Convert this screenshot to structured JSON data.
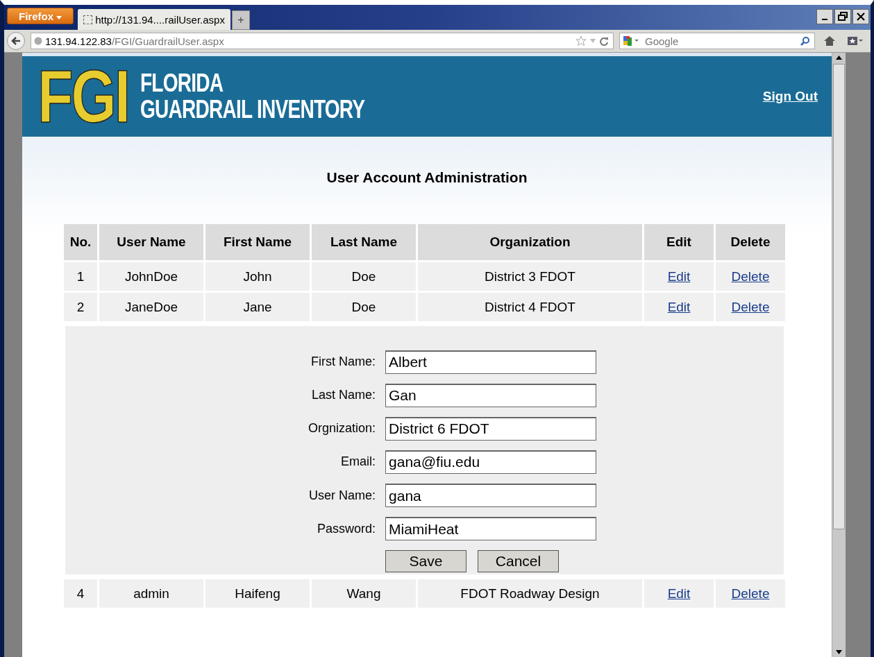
{
  "browser": {
    "menu_button": "Firefox",
    "tabs": [
      {
        "title": "http://131.94....railUser.aspx",
        "selected": true
      }
    ],
    "new_tab": "+",
    "url_host": "131.94.122.83",
    "url_path": "/FGI/GuardrailUser.aspx",
    "search_placeholder": "Google"
  },
  "header": {
    "logo_mark": "FGI",
    "logo_lines": [
      "FLORIDA",
      "GUARDRAIL INVENTORY"
    ],
    "sign_out": "Sign Out"
  },
  "page_title": "User Account Administration",
  "table": {
    "columns": [
      "No.",
      "User Name",
      "First Name",
      "Last Name",
      "Organization",
      "Edit",
      "Delete"
    ],
    "rows": [
      {
        "kind": "data",
        "cells": [
          "1",
          "JohnDoe",
          "John",
          "Doe",
          "District 3 FDOT"
        ],
        "edit": "Edit",
        "delete": "Delete"
      },
      {
        "kind": "data",
        "cells": [
          "2",
          "JaneDoe",
          "Jane",
          "Doe",
          "District 4 FDOT"
        ],
        "edit": "Edit",
        "delete": "Delete"
      },
      {
        "kind": "editor",
        "fields": [
          {
            "label": "First Name:",
            "value": "Albert"
          },
          {
            "label": "Last Name:",
            "value": "Gan"
          },
          {
            "label": "Orgnization:",
            "value": "District 6 FDOT"
          },
          {
            "label": "Email:",
            "value": "gana@fiu.edu"
          },
          {
            "label": "User Name:",
            "value": "gana"
          },
          {
            "label": "Password:",
            "value": "MiamiHeat"
          }
        ],
        "buttons": [
          "Save",
          "Cancel"
        ]
      },
      {
        "kind": "data",
        "cells": [
          "4",
          "admin",
          "Haifeng",
          "Wang",
          "FDOT Roadway Design"
        ],
        "edit": "Edit",
        "delete": "Delete"
      }
    ]
  }
}
